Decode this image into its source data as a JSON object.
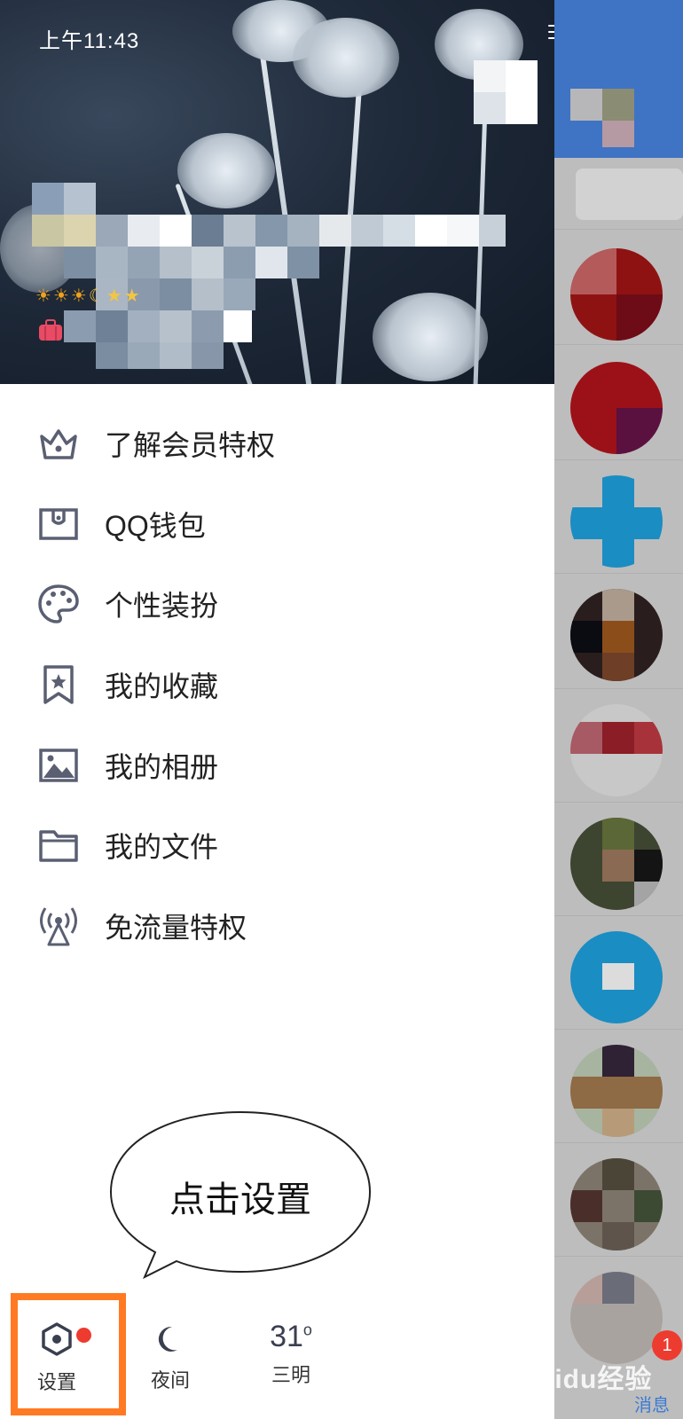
{
  "status_bar": {
    "time": "上午11:43"
  },
  "profile": {
    "level_icons": [
      "sun-icon",
      "sun-icon",
      "sun-icon",
      "moon-icon",
      "star-icon",
      "star-icon"
    ]
  },
  "menu": {
    "items": [
      {
        "label": "了解会员特权",
        "icon": "crown-icon"
      },
      {
        "label": "QQ钱包",
        "icon": "wallet-icon"
      },
      {
        "label": "个性装扮",
        "icon": "palette-icon"
      },
      {
        "label": "我的收藏",
        "icon": "bookmark-star-icon"
      },
      {
        "label": "我的相册",
        "icon": "photo-icon"
      },
      {
        "label": "我的文件",
        "icon": "folder-icon"
      },
      {
        "label": "免流量特权",
        "icon": "signal-tower-icon"
      }
    ]
  },
  "callout": {
    "text": "点击设置"
  },
  "bottom_bar": {
    "settings_label": "设置",
    "night_label": "夜间",
    "weather_temp": "31",
    "weather_unit": "o",
    "weather_city": "三明"
  },
  "right_panel": {
    "unread_badge": "1",
    "messages_tab": "消息",
    "watermark": "Baidu经验"
  },
  "colors": {
    "accent_orange": "#ff7a22",
    "notification_red": "#ee3b2f",
    "icon_gray": "#5a5f72",
    "qq_blue": "#3f73c4"
  }
}
